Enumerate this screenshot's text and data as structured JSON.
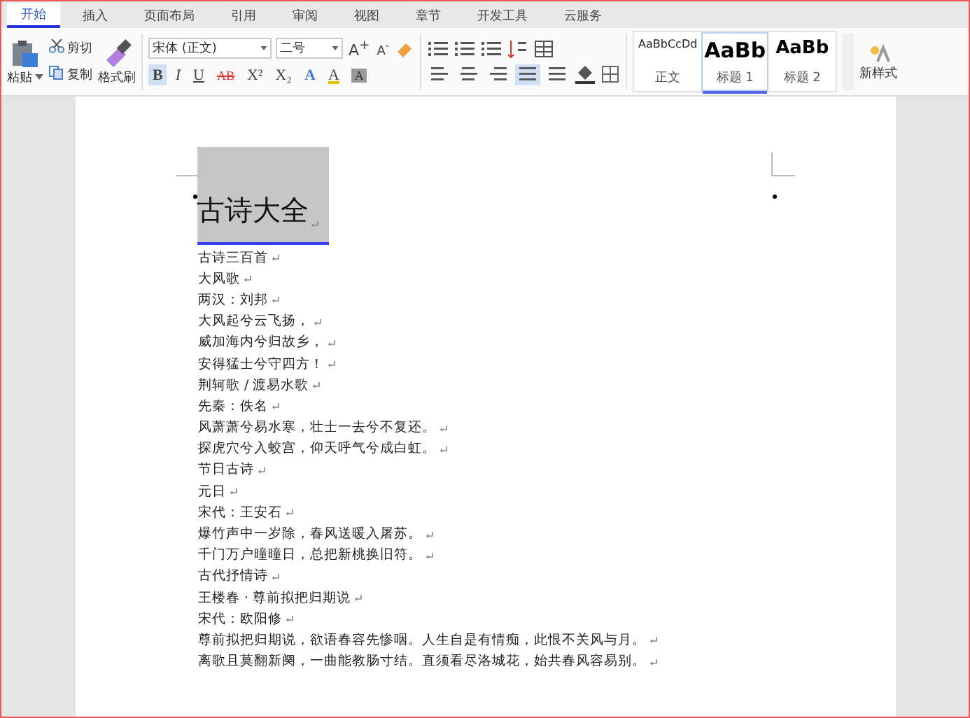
{
  "tabs": [
    {
      "label": "开始",
      "selected": true
    },
    {
      "label": "插入",
      "selected": false
    },
    {
      "label": "页面布局",
      "selected": false
    },
    {
      "label": "引用",
      "selected": false
    },
    {
      "label": "审阅",
      "selected": false
    },
    {
      "label": "视图",
      "selected": false
    },
    {
      "label": "章节",
      "selected": false
    },
    {
      "label": "开发工具",
      "selected": false
    },
    {
      "label": "云服务",
      "selected": false
    }
  ],
  "clipboard": {
    "paste": "粘贴",
    "cut": "剪切",
    "copy": "复制",
    "format_painter": "格式刷"
  },
  "font": {
    "name": "宋体 (正文)",
    "size": "二号",
    "grow": "A$^{+}$",
    "shrink": "A$^{-}$"
  },
  "format_buttons": [
    {
      "label": "B",
      "kind": "bold",
      "selected": true
    },
    {
      "label": "I",
      "kind": "italic",
      "selected": false
    },
    {
      "label": "U",
      "kind": "underline",
      "selected": false
    },
    {
      "label": "AB",
      "kind": "strike",
      "selected": false
    },
    {
      "label": "X²",
      "kind": "plain",
      "selected": false
    },
    {
      "label": "X₂",
      "kind": "plain",
      "selected": false
    },
    {
      "label": "A",
      "kind": "effect",
      "selected": false
    },
    {
      "label": "A",
      "kind": "color",
      "selected": false
    },
    {
      "label": "A",
      "kind": "shade",
      "selected": false
    }
  ],
  "paragraph_buttons": [
    {
      "kind": "left",
      "selected": false
    },
    {
      "kind": "center",
      "selected": false
    },
    {
      "kind": "right",
      "selected": false
    },
    {
      "kind": "justify",
      "selected": true
    },
    {
      "kind": "distribute",
      "selected": false
    }
  ],
  "styles": [
    {
      "sample": "AaBbCcDd",
      "label": "正文",
      "kind": "body",
      "selected": false
    },
    {
      "sample": "AaBb",
      "label": "标题 1",
      "kind": "h1",
      "selected": true
    },
    {
      "sample": "AaBb",
      "label": "标题 2",
      "kind": "h2",
      "selected": false
    }
  ],
  "new_style": "新样式",
  "document": {
    "title": "古诗大全",
    "lines": [
      "古诗三百首",
      "大风歌",
      "两汉：刘邦",
      "大风起兮云飞扬，",
      "威加海内兮归故乡，",
      "安得猛士兮守四方！",
      "荆轲歌 / 渡易水歌",
      "先秦：佚名",
      "风萧萧兮易水寒，壮士一去兮不复还。",
      "探虎穴兮入蛟宫，仰天呼气兮成白虹。",
      "节日古诗",
      "元日",
      "宋代：王安石",
      "爆竹声中一岁除，春风送暖入屠苏。",
      "千门万户曈曈日，总把新桃换旧符。",
      "古代抒情诗",
      "王楼春 · 尊前拟把归期说",
      "宋代：欧阳修",
      "尊前拟把归期说，欲语春容先惨咽。人生自是有情痴，此恨不关风与月。",
      "离歌且莫翻新阕，一曲能教肠寸结。直须看尽洛城花，始共春风容易别。"
    ]
  }
}
